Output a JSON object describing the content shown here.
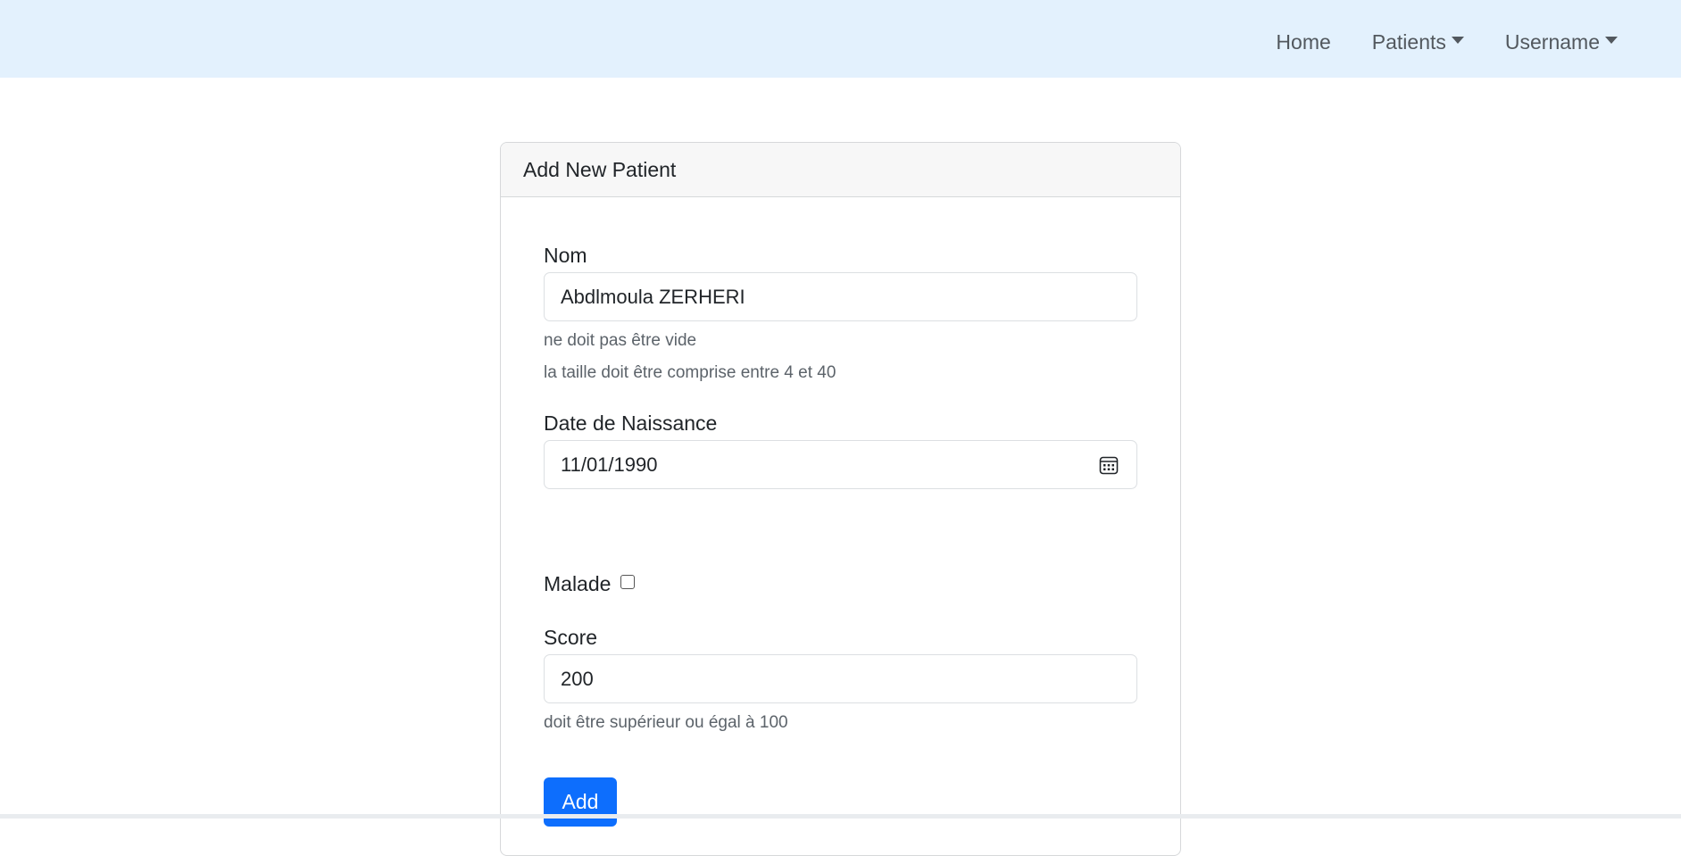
{
  "nav": {
    "home": "Home",
    "patients": "Patients",
    "username": "Username"
  },
  "card": {
    "title": "Add New Patient"
  },
  "form": {
    "nom": {
      "label": "Nom",
      "value": "Abdlmoula ZERHERI",
      "errors": [
        "ne doit pas être vide",
        "la taille doit être comprise entre 4 et 40"
      ]
    },
    "date": {
      "label": "Date de Naissance",
      "value": "11/01/1990",
      "icon": "calendar-icon"
    },
    "malade": {
      "label": "Malade",
      "checked": false
    },
    "score": {
      "label": "Score",
      "value": "200",
      "errors": [
        "doit être supérieur ou égal à 100"
      ]
    },
    "submit_label": "Add"
  },
  "colors": {
    "navbar_bg": "#e3f1fd",
    "primary": "#0d6efd",
    "card_header_bg": "#f7f7f7"
  }
}
